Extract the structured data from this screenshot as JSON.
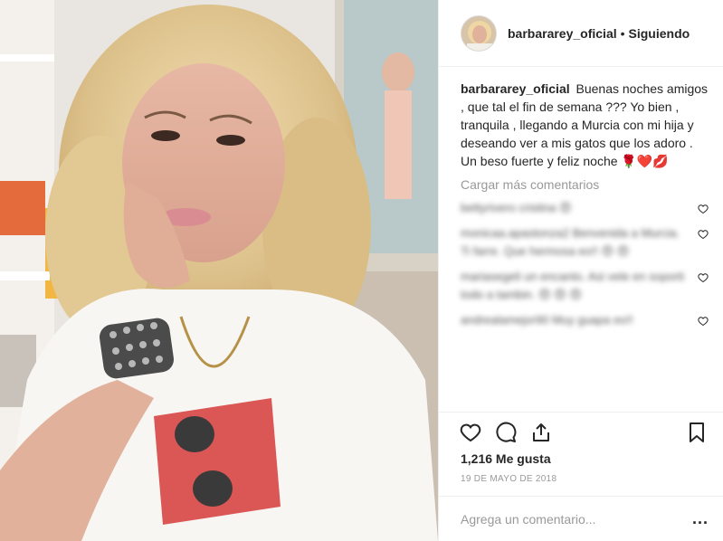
{
  "post": {
    "username": "barbararey_oficial",
    "follow_separator": "•",
    "follow_label": "Siguiendo",
    "caption": "Buenas noches amigos , que tal el fin de semana ??? Yo bien , tranquila , llegando a Murcia con mi hija y deseando ver a mis gatos que los adoro . Un beso fuerte y feliz noche 🌹❤️💋",
    "load_more": "Cargar más comentarios",
    "comments": [
      {
        "text": "bettyrivero cristina 😍"
      },
      {
        "text": "monicaa.apastonza2 Benvenida a Murcia. Ti farre. Que hermosa eo!! 😍 😍"
      },
      {
        "text": "mariasegeli un encanto. Asi vele en soporti todo a tambin. 😍 😍 😍"
      },
      {
        "text": "andrealamejor90 Muy guapa eo!!"
      }
    ],
    "likes": "1,216 Me gusta",
    "date": "19 DE MAYO DE 2018",
    "comment_placeholder": "Agrega un comentario...",
    "more_options": "..."
  },
  "icons": {
    "like": "heart-icon",
    "comment": "comment-bubble-icon",
    "share": "share-icon",
    "save": "bookmark-icon"
  }
}
